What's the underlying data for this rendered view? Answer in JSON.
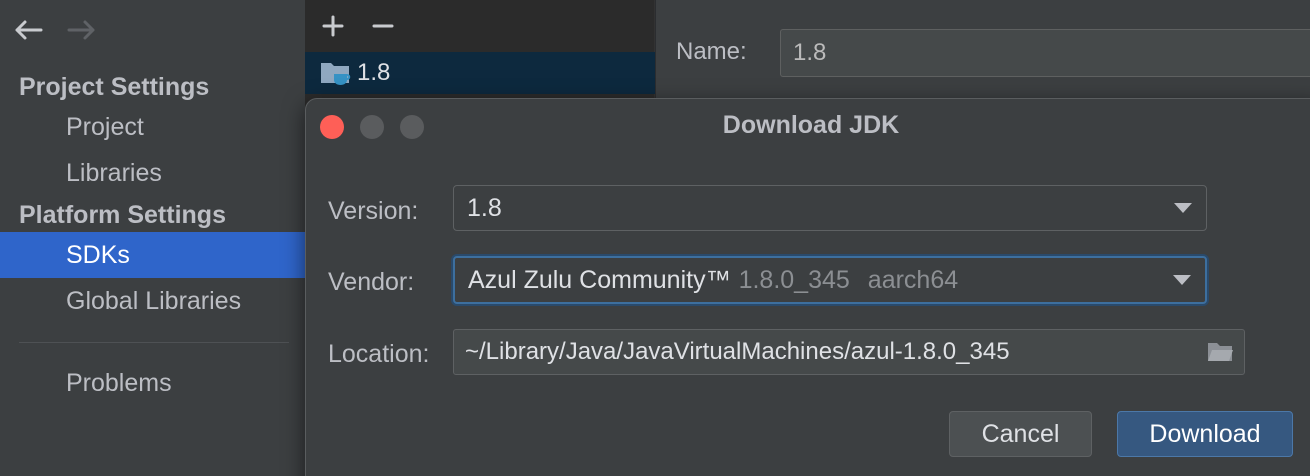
{
  "sidebar": {
    "project_settings_header": "Project Settings",
    "platform_settings_header": "Platform Settings",
    "items": [
      {
        "label": "Project"
      },
      {
        "label": "Libraries"
      },
      {
        "label": "SDKs"
      },
      {
        "label": "Global Libraries"
      },
      {
        "label": "Problems"
      }
    ],
    "back_icon": "arrow-left-icon",
    "forward_icon": "arrow-right-icon"
  },
  "sdk_list": {
    "add_label": "+",
    "remove_label": "−",
    "items": [
      {
        "label": "1.8",
        "icon": "jdk-folder-icon"
      }
    ]
  },
  "details": {
    "name_label": "Name:",
    "name_value": "1.8"
  },
  "dialog": {
    "title": "Download JDK",
    "version_label": "Version:",
    "version_value": "1.8",
    "vendor_label": "Vendor:",
    "vendor_name": "Azul Zulu Community™",
    "vendor_version": "1.8.0_345",
    "vendor_arch": "aarch64",
    "location_label": "Location:",
    "location_value": "~/Library/Java/JavaVirtualMachines/azul-1.8.0_345",
    "cancel_label": "Cancel",
    "download_label": "Download"
  },
  "colors": {
    "selection": "#2f65ca",
    "close_button": "#fe5f57",
    "primary_button": "#365880",
    "focus_ring": "#3d6f9e"
  }
}
